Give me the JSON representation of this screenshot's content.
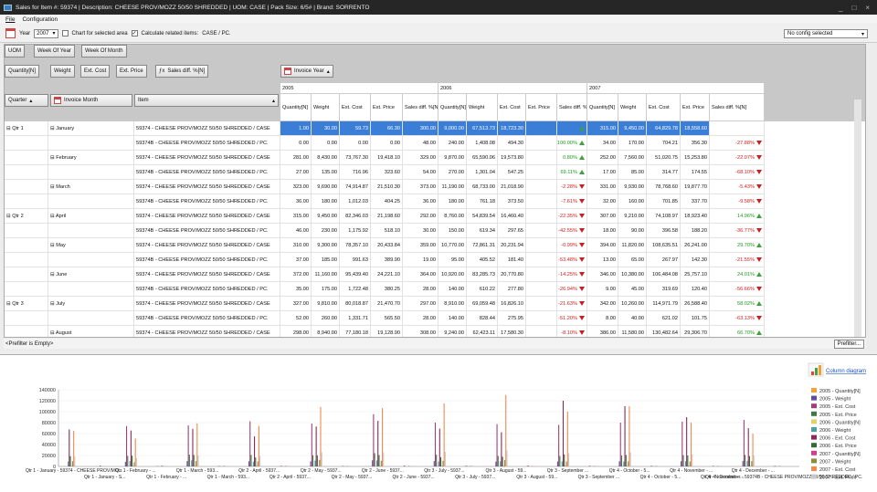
{
  "window": {
    "title": "Sales for Item #: 59374 | Description: CHEESE PROV/MOZZ 50/50 SHREDDED | UOM: CASE | Pack Size: 6/5# | Brand: SORRENTO"
  },
  "menu": [
    "File",
    "Configuration"
  ],
  "toolbar": {
    "year_label": "Year",
    "year_value": "2007",
    "chart_selected": "Chart for selected area",
    "calc_related": "Calculate related items:",
    "calc_items": "CASE  /  PC.",
    "config": "No config selected"
  },
  "fields": {
    "uom": "UOM",
    "week_of_year": "Week Of Year",
    "week_of_month": "Week Of Month",
    "quantity": "Quantity[N]",
    "weight": "Weight",
    "ext_cost": "Ext. Cost",
    "ext_price": "Ext. Price",
    "sales_diff": "Sales diff. %[N]",
    "invoice_year": "Invoice Year",
    "quarter": "Quarter",
    "invoice_month": "Invoice Month",
    "item": "Item"
  },
  "years": [
    "2005",
    "2006",
    "2007"
  ],
  "colnames": [
    "Quantity[N]",
    "Weight",
    "Ext. Cost",
    "Ext. Price",
    "Sales diff. %[N]"
  ],
  "rows": [
    {
      "q": "Qtr 1",
      "m": "January",
      "item": "59374 - CHEESE PROV/MOZZ 50/50 SHREDDED / CASE",
      "v": [
        "1.00",
        "30.00",
        "59.73",
        "66.30",
        "300.00",
        "9,000.00",
        "67,513.73",
        "18,723.30",
        "",
        "",
        "315.00",
        "9,450.00",
        "64,829.78",
        "18,558.60",
        ""
      ],
      "d6": "",
      "d7": "",
      "sel": true
    },
    {
      "q": "",
      "m": "",
      "item": "59374B - CHEESE PROV/MOZZ 50/50 SHREDDED / PC.",
      "v": [
        "0.00",
        "0.00",
        "0.00",
        "0.00",
        "48.00",
        "240.00",
        "1,408.08",
        "494.30",
        "",
        "",
        "34.00",
        "170.00",
        "704.21",
        "356.30",
        ""
      ],
      "d6": "100.00%",
      "d6s": "pos",
      "d7": "-27.88%",
      "d7s": "neg"
    },
    {
      "q": "",
      "m": "February",
      "item": "59374 - CHEESE PROV/MOZZ 50/50 SHREDDED / CASE",
      "v": [
        "281.00",
        "8,430.00",
        "73,767.30",
        "19,418.10",
        "329.00",
        "9,870.00",
        "65,590.06",
        "19,573.80",
        "",
        "",
        "252.00",
        "7,560.00",
        "51,020.75",
        "15,253.80",
        ""
      ],
      "d6": "0.80%",
      "d6s": "pos",
      "d7": "-22.07%",
      "d7s": "neg"
    },
    {
      "q": "",
      "m": "",
      "item": "59374B - CHEESE PROV/MOZZ 50/50 SHREDDED / PC.",
      "v": [
        "27.00",
        "135.00",
        "716.96",
        "323.60",
        "54.00",
        "270.00",
        "1,301.04",
        "547.25",
        "",
        "",
        "17.00",
        "85.00",
        "314.77",
        "174.55",
        ""
      ],
      "d6": "69.11%",
      "d6s": "pos",
      "d7": "-68.10%",
      "d7s": "neg"
    },
    {
      "q": "",
      "m": "March",
      "item": "59374 - CHEESE PROV/MOZZ 50/50 SHREDDED / CASE",
      "v": [
        "323.00",
        "9,690.00",
        "74,914.87",
        "21,510.30",
        "373.00",
        "11,190.00",
        "68,733.00",
        "21,018.90",
        "",
        "",
        "331.00",
        "9,930.00",
        "78,768.60",
        "19,877.70",
        ""
      ],
      "d6": "-2.28%",
      "d6s": "neg",
      "d7": "-5.43%",
      "d7s": "neg"
    },
    {
      "q": "",
      "m": "",
      "item": "59374B - CHEESE PROV/MOZZ 50/50 SHREDDED / PC.",
      "v": [
        "36.00",
        "180.00",
        "1,012.03",
        "404.25",
        "36.00",
        "180.00",
        "761.18",
        "373.50",
        "",
        "",
        "32.00",
        "160.00",
        "701.85",
        "337.70",
        ""
      ],
      "d6": "-7.61%",
      "d6s": "neg",
      "d7": "-9.58%",
      "d7s": "neg"
    },
    {
      "q": "Qtr 2",
      "m": "April",
      "item": "59374 - CHEESE PROV/MOZZ 50/50 SHREDDED / CASE",
      "v": [
        "315.00",
        "9,450.00",
        "82,346.03",
        "21,198.60",
        "292.00",
        "8,760.00",
        "54,839.54",
        "16,460.40",
        "",
        "",
        "307.00",
        "9,210.00",
        "74,108.97",
        "18,923.40",
        ""
      ],
      "d6": "-22.35%",
      "d6s": "neg",
      "d7": "14.96%",
      "d7s": "pos"
    },
    {
      "q": "",
      "m": "",
      "item": "59374B - CHEESE PROV/MOZZ 50/50 SHREDDED / PC.",
      "v": [
        "46.00",
        "230.00",
        "1,175.92",
        "518.10",
        "30.00",
        "150.00",
        "619.34",
        "297.65",
        "",
        "",
        "18.00",
        "90.00",
        "396.58",
        "188.20",
        ""
      ],
      "d6": "-42.55%",
      "d6s": "neg",
      "d7": "-36.77%",
      "d7s": "neg"
    },
    {
      "q": "",
      "m": "May",
      "item": "59374 - CHEESE PROV/MOZZ 50/50 SHREDDED / CASE",
      "v": [
        "310.00",
        "9,300.00",
        "78,357.10",
        "20,433.84",
        "359.00",
        "10,770.00",
        "72,861.31",
        "20,231.94",
        "",
        "",
        "394.00",
        "11,820.00",
        "108,635.51",
        "26,241.00",
        ""
      ],
      "d6": "-0.99%",
      "d6s": "neg",
      "d7": "29.70%",
      "d7s": "pos"
    },
    {
      "q": "",
      "m": "",
      "item": "59374B - CHEESE PROV/MOZZ 50/50 SHREDDED / PC.",
      "v": [
        "37.00",
        "185.00",
        "991.63",
        "389.90",
        "19.00",
        "95.00",
        "405.52",
        "181.40",
        "",
        "",
        "13.00",
        "65.00",
        "267.97",
        "142.30",
        ""
      ],
      "d6": "-53.48%",
      "d6s": "neg",
      "d7": "-21.55%",
      "d7s": "neg"
    },
    {
      "q": "",
      "m": "June",
      "item": "59374 - CHEESE PROV/MOZZ 50/50 SHREDDED / CASE",
      "v": [
        "372.00",
        "11,160.00",
        "95,439.40",
        "24,221.10",
        "364.00",
        "10,920.00",
        "83,285.73",
        "20,770.80",
        "",
        "",
        "346.00",
        "10,380.00",
        "106,484.08",
        "25,757.10",
        ""
      ],
      "d6": "-14.25%",
      "d6s": "neg",
      "d7": "24.01%",
      "d7s": "pos"
    },
    {
      "q": "",
      "m": "",
      "item": "59374B - CHEESE PROV/MOZZ 50/50 SHREDDED / PC.",
      "v": [
        "35.00",
        "175.00",
        "1,722.48",
        "380.25",
        "28.00",
        "140.00",
        "610.22",
        "277.80",
        "",
        "",
        "9.00",
        "45.00",
        "319.69",
        "120.40",
        ""
      ],
      "d6": "-26.94%",
      "d6s": "neg",
      "d7": "-56.66%",
      "d7s": "neg"
    },
    {
      "q": "Qtr 3",
      "m": "July",
      "item": "59374 - CHEESE PROV/MOZZ 50/50 SHREDDED / CASE",
      "v": [
        "327.00",
        "9,810.00",
        "80,018.87",
        "21,470.70",
        "297.00",
        "8,910.00",
        "69,059.48",
        "16,826.10",
        "",
        "",
        "342.00",
        "10,260.00",
        "114,971.79",
        "26,588.40",
        ""
      ],
      "d6": "-21.63%",
      "d6s": "neg",
      "d7": "58.02%",
      "d7s": "pos"
    },
    {
      "q": "",
      "m": "",
      "item": "59374B - CHEESE PROV/MOZZ 50/50 SHREDDED / PC.",
      "v": [
        "52.00",
        "260.00",
        "1,331.71",
        "565.50",
        "28.00",
        "140.00",
        "828.44",
        "275.95",
        "",
        "",
        "8.00",
        "40.00",
        "621.02",
        "101.75",
        ""
      ],
      "d6": "-51.20%",
      "d6s": "neg",
      "d7": "-63.13%",
      "d7s": "neg"
    },
    {
      "q": "",
      "m": "August",
      "item": "59374 - CHEESE PROV/MOZZ 50/50 SHREDDED / CASE",
      "v": [
        "298.00",
        "8,940.00",
        "77,180.18",
        "19,128.90",
        "308.00",
        "9,240.00",
        "62,423.11",
        "17,580.30",
        "",
        "",
        "386.00",
        "11,580.00",
        "130,482.64",
        "29,306.70",
        ""
      ],
      "d6": "-8.10%",
      "d6s": "neg",
      "d7": "66.70%",
      "d7s": "pos"
    },
    {
      "q": "",
      "m": "",
      "item": "59374B - CHEESE PROV/MOZZ 50/50 SHREDDED / PC.",
      "v": [
        "48.00",
        "240.00",
        "1,718.87",
        "515.25",
        "25.00",
        "125.00",
        "441.27",
        "249.65",
        "",
        "",
        "23.00",
        "115.00",
        "594.05",
        "293.80",
        ""
      ],
      "d6": "-51.55%",
      "d6s": "neg",
      "d7": "17.68%",
      "d7s": "pos"
    }
  ],
  "filter": {
    "text": "<Prefilter is Empty>",
    "button": "Prefilter..."
  },
  "chart_data": {
    "type": "bar",
    "ylim": [
      0,
      140000
    ],
    "yticks": [
      "140000",
      "120000",
      "100000",
      "80000",
      "60000",
      "40000",
      "20000",
      "0"
    ],
    "column_diagram": "Column diagram",
    "categories": [
      "Qtr 1 - January - 59374 - CHEESE PROV/MO...",
      "Qtr 1 - January - S...",
      "Qtr 1 - February - ...",
      "Qtr 1 - February - ...",
      "Qtr 1 - March - 593...",
      "Qtr 1 - March - 593...",
      "Qtr 2 - April - 5937...",
      "Qtr 2 - April - 5937...",
      "Qtr 2 - May - 5937...",
      "Qtr 2 - May - 5937...",
      "Qtr 2 - June - 5937...",
      "Qtr 2 - June - 5937...",
      "Qtr 3 - July - 5937...",
      "Qtr 3 - July - 5937...",
      "Qtr 3 - August - 59...",
      "Qtr 3 - August - 59...",
      "Qtr 3 - September ...",
      "Qtr 3 - September ...",
      "Qtr 4 - October - 5...",
      "Qtr 4 - October - 5...",
      "Qtr 4 - November - ...",
      "Qtr 4 - November - ...",
      "Qtr 4 - December - ...",
      "Qtr 4 - December - 59374B - CHEESE PROV/MOZZ 50/50 SHREDDED / PC."
    ],
    "series": [
      {
        "name": "2005 - Quantity[N]",
        "color": "#f2a23a",
        "values": [
          1,
          0,
          281,
          27,
          323,
          36,
          315,
          46,
          310,
          37,
          372,
          35,
          327,
          52,
          298,
          48,
          300,
          40,
          310,
          45,
          320,
          38,
          330,
          40
        ]
      },
      {
        "name": "2005 - Weight",
        "color": "#5b4fa0",
        "values": [
          30,
          0,
          8430,
          135,
          9690,
          180,
          9450,
          230,
          9300,
          185,
          11160,
          175,
          9810,
          260,
          8940,
          240,
          9000,
          200,
          9300,
          225,
          9600,
          190,
          9900,
          200
        ]
      },
      {
        "name": "2005 - Ext. Cost",
        "color": "#a0407a",
        "values": [
          60,
          0,
          73767,
          717,
          74915,
          1012,
          82346,
          1176,
          78357,
          992,
          95439,
          1722,
          80019,
          1332,
          77180,
          1719,
          76000,
          1200,
          80000,
          1300,
          82000,
          1100,
          85000,
          1200
        ]
      },
      {
        "name": "2005 - Ext. Price",
        "color": "#3d7a46",
        "values": [
          66,
          0,
          19418,
          324,
          21510,
          404,
          21199,
          518,
          20434,
          390,
          24221,
          380,
          21471,
          566,
          19129,
          515,
          19000,
          450,
          20000,
          480,
          20500,
          420,
          21000,
          430
        ]
      },
      {
        "name": "2006 - Quantity[N]",
        "color": "#e0d36a",
        "values": [
          300,
          48,
          329,
          54,
          373,
          36,
          292,
          30,
          359,
          19,
          364,
          28,
          297,
          28,
          308,
          25,
          310,
          26,
          300,
          24,
          320,
          22,
          330,
          25
        ]
      },
      {
        "name": "2006 - Weight",
        "color": "#4aa0a8",
        "values": [
          9000,
          240,
          9870,
          270,
          11190,
          180,
          8760,
          150,
          10770,
          95,
          10920,
          140,
          8910,
          140,
          9240,
          125,
          9300,
          130,
          9000,
          120,
          9600,
          110,
          9900,
          125
        ]
      },
      {
        "name": "2006 - Ext. Cost",
        "color": "#8a2b5a",
        "values": [
          67514,
          1408,
          65590,
          1301,
          68733,
          761,
          54840,
          619,
          72861,
          406,
          83286,
          610,
          69059,
          828,
          62423,
          441,
          120000,
          600,
          110000,
          550,
          90000,
          500,
          70000,
          550
        ]
      },
      {
        "name": "2006 - Ext. Price",
        "color": "#356b3a",
        "values": [
          18723,
          494,
          19574,
          547,
          21019,
          374,
          16460,
          298,
          20232,
          181,
          20771,
          278,
          16826,
          276,
          17580,
          250,
          22000,
          260,
          21000,
          250,
          20000,
          240,
          19000,
          250
        ]
      },
      {
        "name": "2007 - Quantity[N]",
        "color": "#d04090",
        "values": [
          315,
          34,
          252,
          17,
          331,
          32,
          307,
          18,
          394,
          13,
          346,
          9,
          342,
          8,
          386,
          23,
          300,
          20,
          310,
          18,
          300,
          16,
          320,
          18
        ]
      },
      {
        "name": "2007 - Weight",
        "color": "#8c8c3a",
        "values": [
          9450,
          170,
          7560,
          85,
          9930,
          160,
          9210,
          90,
          11820,
          65,
          10380,
          45,
          10260,
          40,
          11580,
          115,
          9000,
          100,
          9300,
          90,
          9000,
          80,
          9600,
          90
        ]
      },
      {
        "name": "2007 - Ext. Cost",
        "color": "#f08a50",
        "values": [
          64830,
          704,
          51021,
          315,
          78769,
          702,
          74109,
          397,
          108636,
          268,
          106484,
          320,
          114972,
          621,
          130483,
          594,
          100000,
          500,
          110000,
          480,
          80000,
          450,
          60000,
          480
        ]
      },
      {
        "name": "2007 - Ext. Price",
        "color": "#c8c8c8",
        "values": [
          18559,
          356,
          15254,
          175,
          19878,
          338,
          18923,
          188,
          26241,
          142,
          25757,
          120,
          26588,
          102,
          29307,
          294,
          24000,
          260,
          26000,
          240,
          22000,
          220,
          20000,
          240
        ]
      }
    ]
  }
}
